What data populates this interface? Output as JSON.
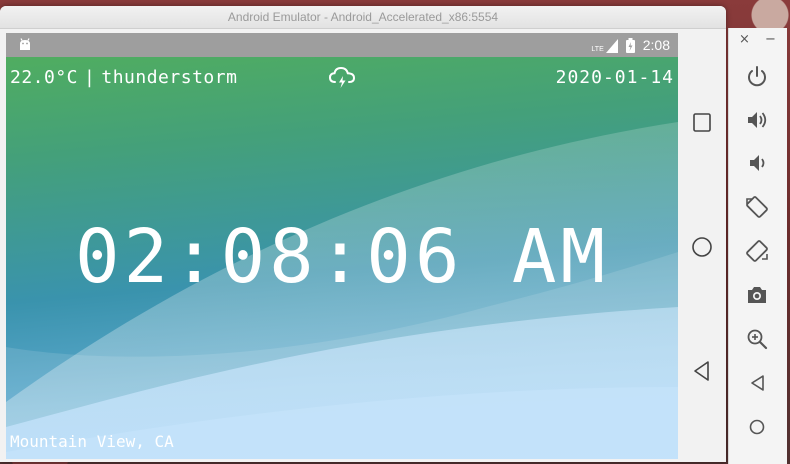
{
  "window": {
    "title": "Android Emulator - Android_Accelerated_x86:5554"
  },
  "status_bar": {
    "network": "LTE",
    "time": "2:08"
  },
  "app": {
    "temperature": "22.0°C",
    "separator": "|",
    "condition": "thunderstorm",
    "weather_icon": "cloud-lightning-icon",
    "date": "2020-01-14",
    "clock": "02:08:06 AM",
    "location": "Mountain View, CA"
  },
  "nav": {
    "buttons": [
      "overview-icon",
      "home-icon",
      "back-icon"
    ]
  },
  "tool_panel": {
    "close": "×",
    "minimize": "−",
    "tools": [
      "power-icon",
      "volume-up-icon",
      "volume-down-icon",
      "rotate-left-icon",
      "rotate-right-icon",
      "camera-icon",
      "zoom-icon",
      "back-icon",
      "home-icon"
    ]
  },
  "colors": {
    "screen_top": "#4caa63",
    "screen_mid": "#3d9aa3",
    "screen_bottom": "#9fd0ee",
    "status_bar": "#9e9e9e"
  }
}
